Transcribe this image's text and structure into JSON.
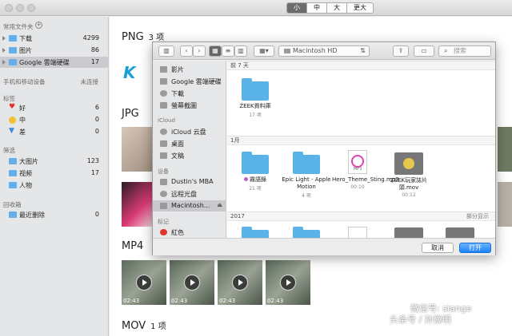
{
  "toolbar": {
    "size_segments": [
      "小",
      "中",
      "大",
      "更大"
    ],
    "selected_segment": "小"
  },
  "sidebar": {
    "sections": {
      "favorites": "常用文件夹",
      "devices": "手机和移动设备",
      "devices_status": "未连接",
      "tags": "标签",
      "filters": "筛选",
      "recycle": "回收箱"
    },
    "favorites": [
      {
        "label": "下载",
        "count": "4299"
      },
      {
        "label": "图片",
        "count": "86"
      },
      {
        "label": "Google 雲端硬碟",
        "count": "17"
      }
    ],
    "tags": [
      {
        "label": "好",
        "count": "6"
      },
      {
        "label": "中",
        "count": "0"
      },
      {
        "label": "差",
        "count": "0"
      }
    ],
    "filters": [
      {
        "label": "大图片",
        "count": "123"
      },
      {
        "label": "视频",
        "count": "17"
      },
      {
        "label": "人物",
        "count": ""
      }
    ],
    "recycle": [
      {
        "label": "最近删除",
        "count": "0"
      }
    ]
  },
  "main": {
    "sections": [
      {
        "title": "PNG",
        "count": "3 项"
      },
      {
        "title": "JPG",
        "count": ""
      },
      {
        "title": "MP4",
        "count": ""
      },
      {
        "title": "MOV",
        "count": "1 项"
      }
    ],
    "video_duration": "02:43"
  },
  "dialog": {
    "location": "Macintosh HD",
    "search_placeholder": "搜索",
    "sidebar": {
      "favorites": [
        {
          "label": "影片"
        },
        {
          "label": "Google 雲端硬碟"
        },
        {
          "label": "下載"
        },
        {
          "label": "螢幕截圖"
        }
      ],
      "icloud_head": "iCloud",
      "icloud": [
        {
          "label": "iCloud 云盘"
        },
        {
          "label": "桌面"
        },
        {
          "label": "文稿"
        }
      ],
      "devices_head": "设备",
      "devices": [
        {
          "label": "Dustin's MBA"
        },
        {
          "label": "远程光盘"
        },
        {
          "label": "Macintosh..."
        }
      ],
      "tags_head": "标记",
      "tags": [
        {
          "label": "紅色"
        }
      ]
    },
    "groups": {
      "recent": "前 7 天",
      "month": "1月",
      "year": "2017",
      "show_more": "部分显示"
    },
    "files_recent": [
      {
        "name": "ZEEK資料庫",
        "sub": "17 项"
      }
    ],
    "files_month": [
      {
        "name": "霧語錄",
        "sub": "21 项",
        "tag": true
      },
      {
        "name": "Epic Light - Apple Motion",
        "sub": "4 项"
      },
      {
        "name": "Hero_Theme_Sting.mp3",
        "sub": "00:10",
        "ext": "MP3"
      },
      {
        "name": "ZEEK玩家誌片頭.mov",
        "sub": "00:12"
      }
    ],
    "cancel_label": "取消",
    "open_label": "打开"
  },
  "watermark": {
    "line1": "微信号: siange",
    "line2": "头条号 / 孙豫明"
  },
  "colors": {
    "accent": "#1a82fb",
    "folder": "#5ab3e8",
    "tag_red": "#e2342d"
  }
}
